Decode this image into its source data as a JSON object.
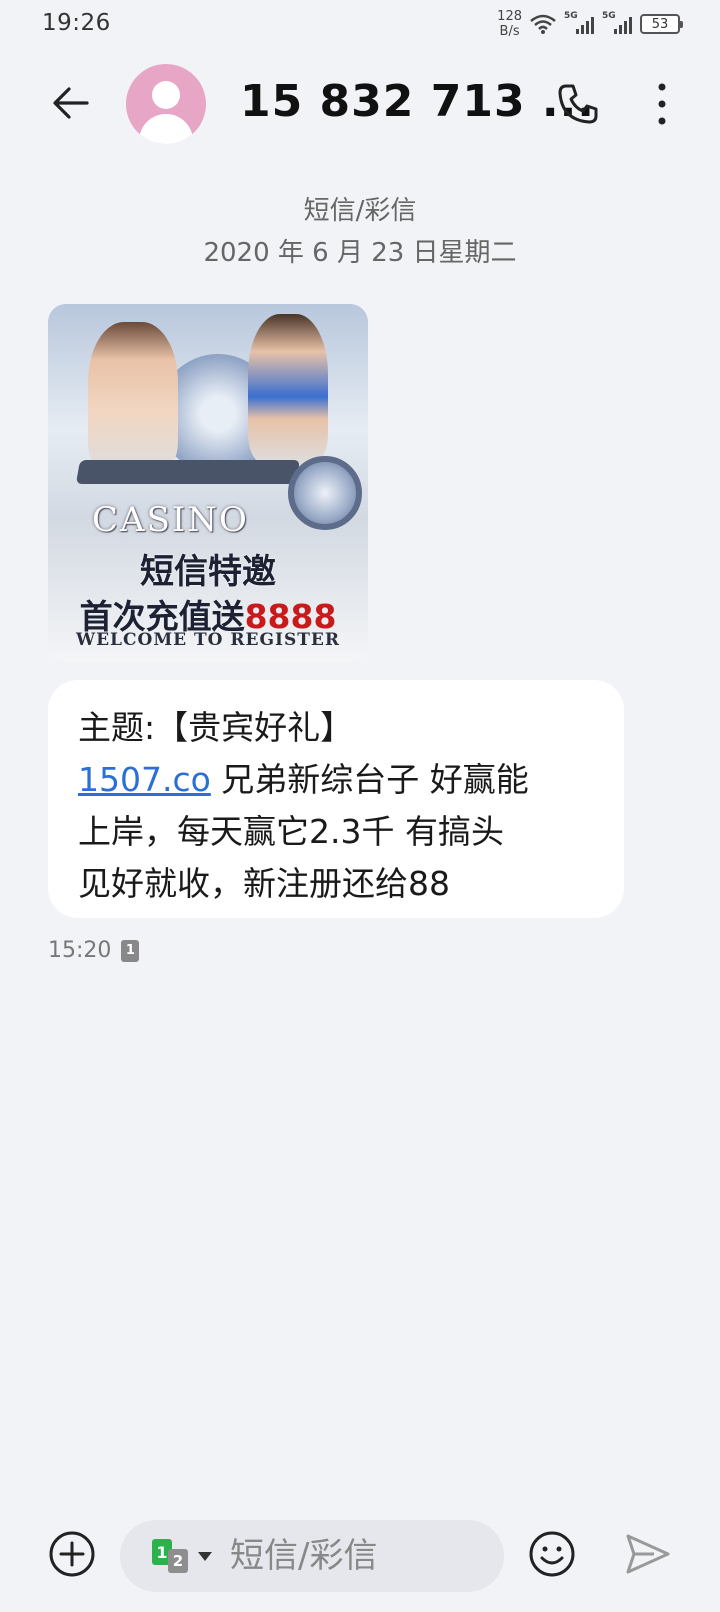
{
  "status_bar": {
    "time": "19:26",
    "net_speed_value": "128",
    "net_speed_unit": "B/s",
    "signal1_tag": "5G",
    "signal2_tag": "5G",
    "battery": "53"
  },
  "header": {
    "contact_name": "15 832 713 ...",
    "icons": [
      "back-arrow-icon",
      "avatar",
      "phone-icon",
      "more-vertical-icon"
    ]
  },
  "conversation": {
    "type_label": "短信/彩信",
    "date": "2020 年 6 月 23 日星期二"
  },
  "image_message": {
    "logo_text": "CASINO",
    "promo_line1": "短信特邀",
    "promo_line2_prefix": "首次充值送",
    "promo_line2_amount": "8888",
    "promo_line3": "WELCOME TO REGISTER"
  },
  "text_message": {
    "line1": "主题:【贵宾好礼】",
    "link": "1507.co",
    "line2_rest": " 兄弟新综台子  好赢能",
    "line3": "上岸，每天赢它2.3千 有搞头",
    "line4": "见好就收，新注册还给88",
    "time": "15:20",
    "sim_badge": "1"
  },
  "composer": {
    "placeholder": "短信/彩信",
    "sim1": "1",
    "sim2": "2",
    "accent_color": "#2ab34a"
  }
}
